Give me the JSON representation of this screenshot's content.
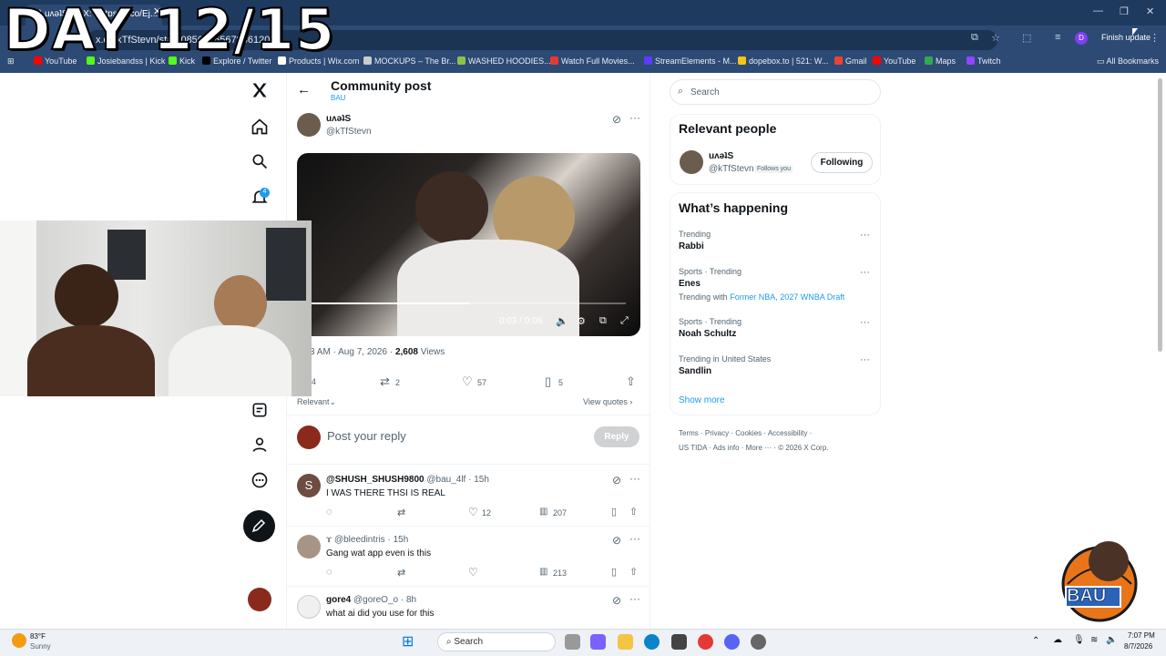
{
  "overlay": {
    "title": "DAY 12/15"
  },
  "browser": {
    "tab_title": "(5) uʌǝʇS on X: \"https://t.co/Ej...",
    "url_prefix": "x.c",
    "url_rest": "kTfStevn/stat",
    "url_tail": "20856",
    "url_mid": "2165",
    "url_mid2": "67846",
    "url_end": "120",
    "finish_update": "Finish update",
    "profile_initial": "D",
    "bookmarks": [
      {
        "label": "YouTube",
        "color": "#ff0000"
      },
      {
        "label": "Josiebandss | Kick",
        "color": "#53fc18"
      },
      {
        "label": "Kick",
        "color": "#53fc18"
      },
      {
        "label": "Explore / Twitter",
        "color": "#000000"
      },
      {
        "label": "Products | Wix.com",
        "color": "#ffffff"
      },
      {
        "label": "MOCKUPS – The Br...",
        "color": "#cccccc"
      },
      {
        "label": "WASHED HOODIES...",
        "color": "#8bc34a"
      },
      {
        "label": "Watch Full Movies...",
        "color": "#e53935"
      },
      {
        "label": "StreamElements - M...",
        "color": "#5c3bfe"
      },
      {
        "label": "dopebox.to | 521: W...",
        "color": "#f5c518"
      },
      {
        "label": "Gmail",
        "color": "#ea4335"
      },
      {
        "label": "YouTube",
        "color": "#ff0000"
      },
      {
        "label": "Maps",
        "color": "#34a853"
      },
      {
        "label": "Twitch",
        "color": "#9146ff"
      }
    ],
    "all_bookmarks": "All Bookmarks"
  },
  "nav": {
    "notifications_count": "4"
  },
  "post": {
    "header_title": "Community post",
    "community": "BAU",
    "author_name": "uʌǝʇS",
    "author_handle": "@kTfStevn",
    "video_time": "0:03 / 0:06",
    "video_progress": 0.5,
    "meta_time": "3 AM · Aug 7, 2026 · ",
    "meta_views_count": "2,608",
    "meta_views_label": " Views",
    "stats": {
      "replies": "4",
      "reposts": "2",
      "likes": "57",
      "bookmarks": "5"
    },
    "sort_label": "Relevant",
    "view_quotes": "View quotes",
    "reply_placeholder": "Post your reply",
    "reply_button": "Reply"
  },
  "replies": [
    {
      "name": "@SHUSH_SHUSH9800",
      "handle": "@bau_4lf",
      "time": "· 15h",
      "text": "I WAS THERE THSI IS REAL",
      "reposts": "",
      "likes": "12",
      "views": "207",
      "avatar_letter": "S"
    },
    {
      "name": "",
      "handle": "ɤ @bleedintris",
      "time": "· 15h",
      "text": "Gang wat app even is this",
      "reposts": "",
      "likes": "",
      "views": "213",
      "avatar_letter": ""
    },
    {
      "name": "gore4",
      "handle": "@goreO_o",
      "time": "· 8h",
      "text": "what ai did you use for this",
      "avatar_letter": ""
    }
  ],
  "sidebar": {
    "search_placeholder": "Search",
    "relevant_title": "Relevant people",
    "person_name": "uʌǝʇS",
    "person_handle": "@kTfStevn",
    "follows_you": "Follows you",
    "follow_button": "Following",
    "happening_title": "What’s happening",
    "trends": [
      {
        "context": "Trending",
        "name": "Rabbi",
        "extra_prefix": "",
        "extra_links": ""
      },
      {
        "context": "Sports · Trending",
        "name": "Enes",
        "extra_prefix": "Trending with ",
        "extra_links": "Former NBA, 2027 WNBA Draft"
      },
      {
        "context": "Sports · Trending",
        "name": "Noah Schultz",
        "extra_prefix": "",
        "extra_links": ""
      },
      {
        "context": "Trending in United States",
        "name": "Sandlin",
        "extra_prefix": "",
        "extra_links": ""
      }
    ],
    "show_more": "Show more",
    "footer_line1": [
      "Terms",
      "Privacy",
      "Cookies",
      "Accessibility"
    ],
    "footer_line2": [
      "US TIDA",
      "Ads info",
      "More ···",
      "© 2026 X Corp."
    ]
  },
  "taskbar": {
    "temp": "83°F",
    "weather": "Sunny",
    "search_label": "Search",
    "time": "7:07 PM",
    "date": "8/7/2026"
  },
  "logo": {
    "text": "BAU"
  }
}
